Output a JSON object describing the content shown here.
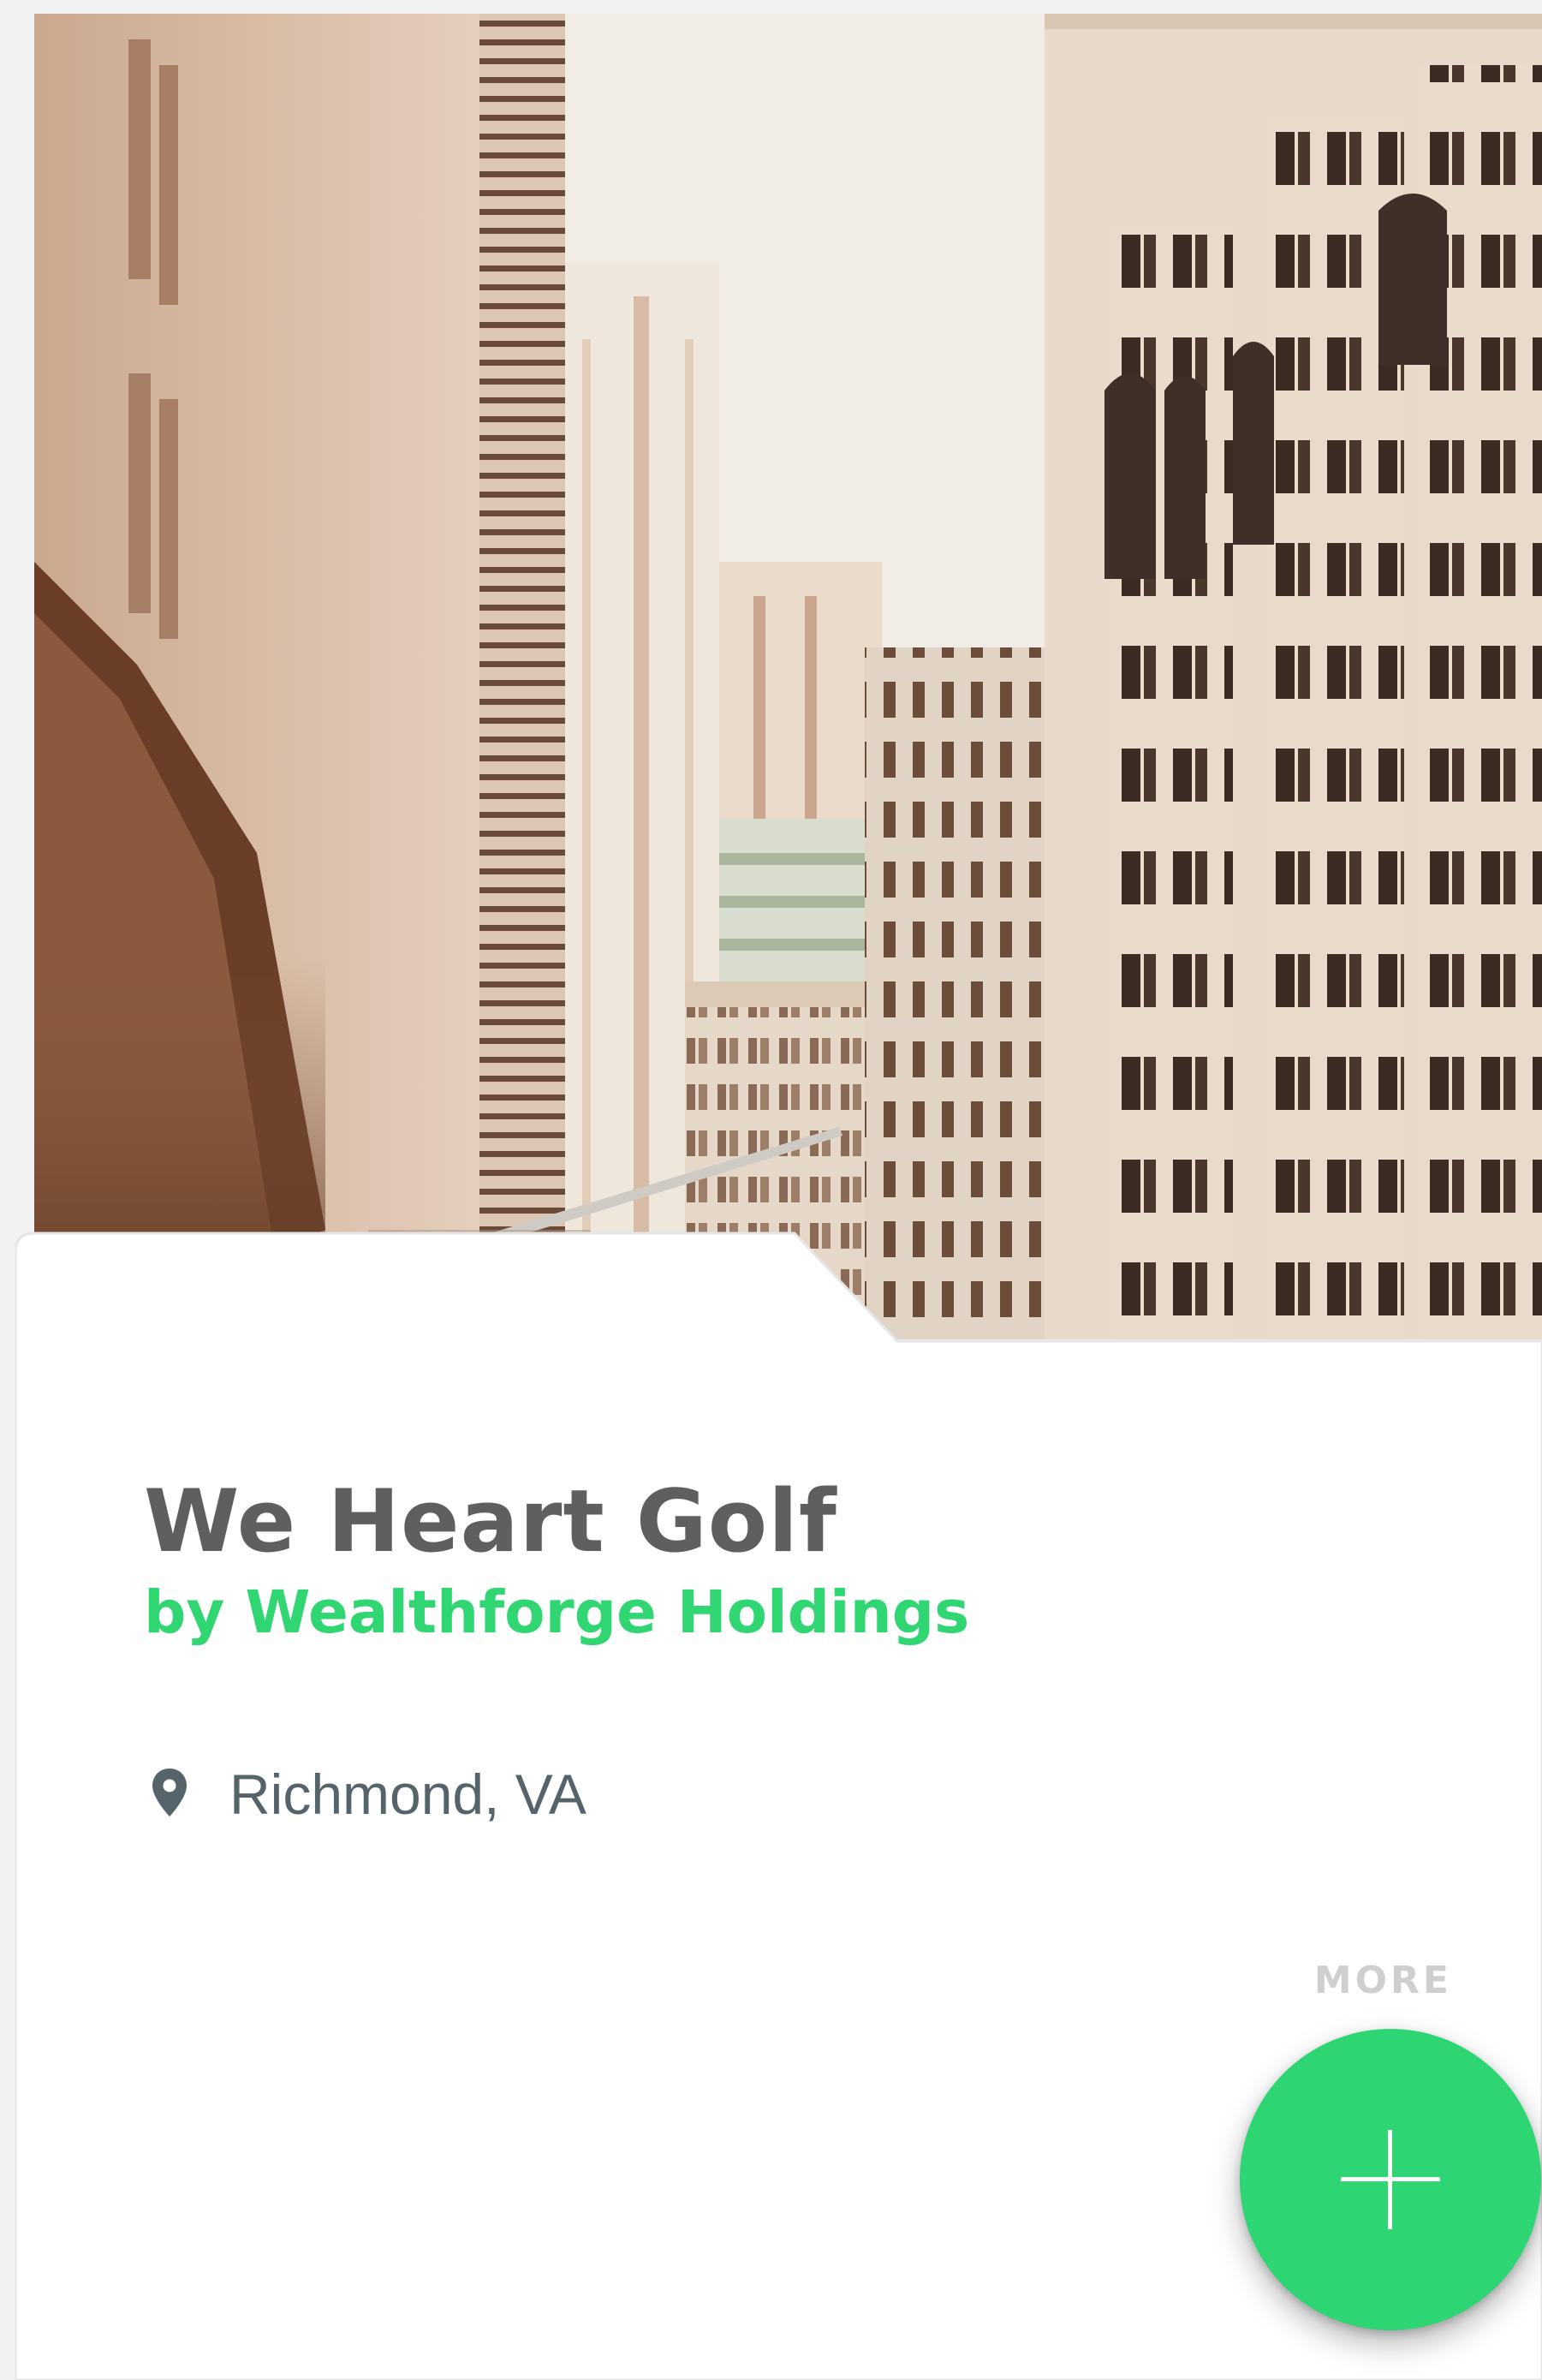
{
  "hero": {
    "image": "city-skyscrapers-photo"
  },
  "listing": {
    "title": "We Heart Golf",
    "byline": "by Wealthforge Holdings",
    "location_icon": "map-pin-icon",
    "location": "Richmond, VA",
    "more_label": "MORE"
  },
  "fab": {
    "icon": "plus-icon",
    "color": "#2ed573"
  },
  "colors": {
    "accent": "#2ed573",
    "title": "#5f5f5f",
    "location": "#55646b",
    "muted": "#cfcfcf"
  }
}
